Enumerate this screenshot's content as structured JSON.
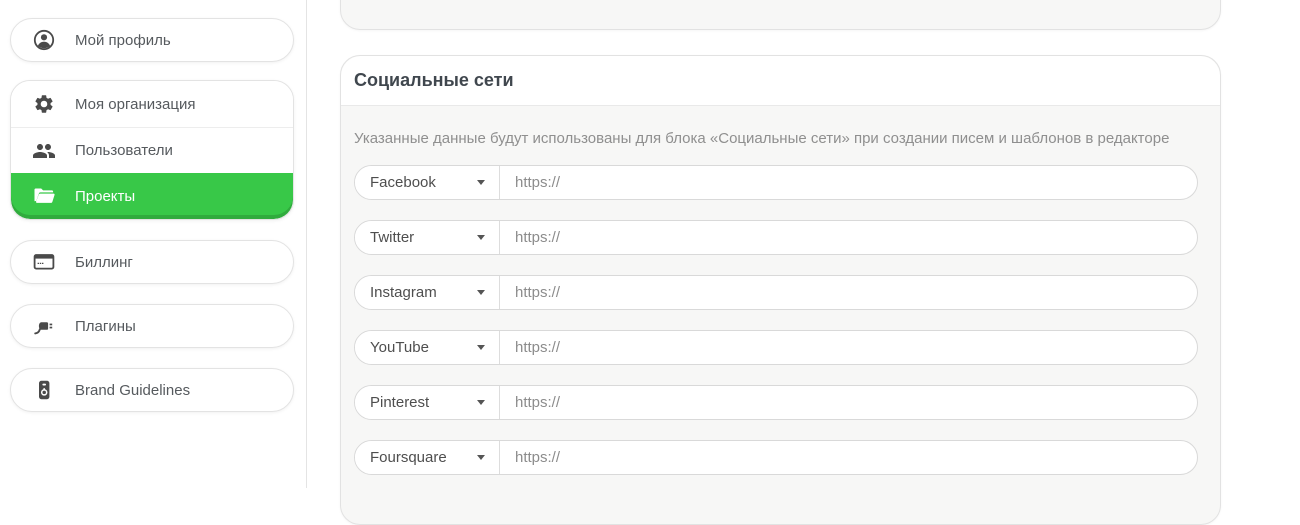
{
  "sidebar": {
    "profile": {
      "label": "Мой профиль",
      "icon": "user-circle-icon"
    },
    "org_group": [
      {
        "label": "Моя организация",
        "icon": "gear-icon",
        "active": false
      },
      {
        "label": "Пользователи",
        "icon": "users-icon",
        "active": false
      },
      {
        "label": "Проекты",
        "icon": "folder-open-icon",
        "active": true
      }
    ],
    "billing": {
      "label": "Биллинг",
      "icon": "credit-card-icon"
    },
    "plugins": {
      "label": "Плагины",
      "icon": "plug-icon"
    },
    "brand": {
      "label": "Brand Guidelines",
      "icon": "brand-book-icon"
    }
  },
  "main": {
    "card": {
      "title": "Социальные сети",
      "description": "Указанные данные будут использованы для блока «Социальные сети» при создании писем и шаблонов в редакторе",
      "rows": [
        {
          "network": "Facebook",
          "url_value": "",
          "url_placeholder": "https://"
        },
        {
          "network": "Twitter",
          "url_value": "",
          "url_placeholder": "https://"
        },
        {
          "network": "Instagram",
          "url_value": "",
          "url_placeholder": "https://"
        },
        {
          "network": "YouTube",
          "url_value": "",
          "url_placeholder": "https://"
        },
        {
          "network": "Pinterest",
          "url_value": "",
          "url_placeholder": "https://"
        },
        {
          "network": "Foursquare",
          "url_value": "",
          "url_placeholder": "https://"
        }
      ]
    }
  },
  "colors": {
    "accent_green": "#38c848",
    "accent_green_dark": "#2dab3c",
    "card_bg": "#f7f7f6",
    "border": "#e2e2e2",
    "icon_gray": "#4a4a4a"
  }
}
